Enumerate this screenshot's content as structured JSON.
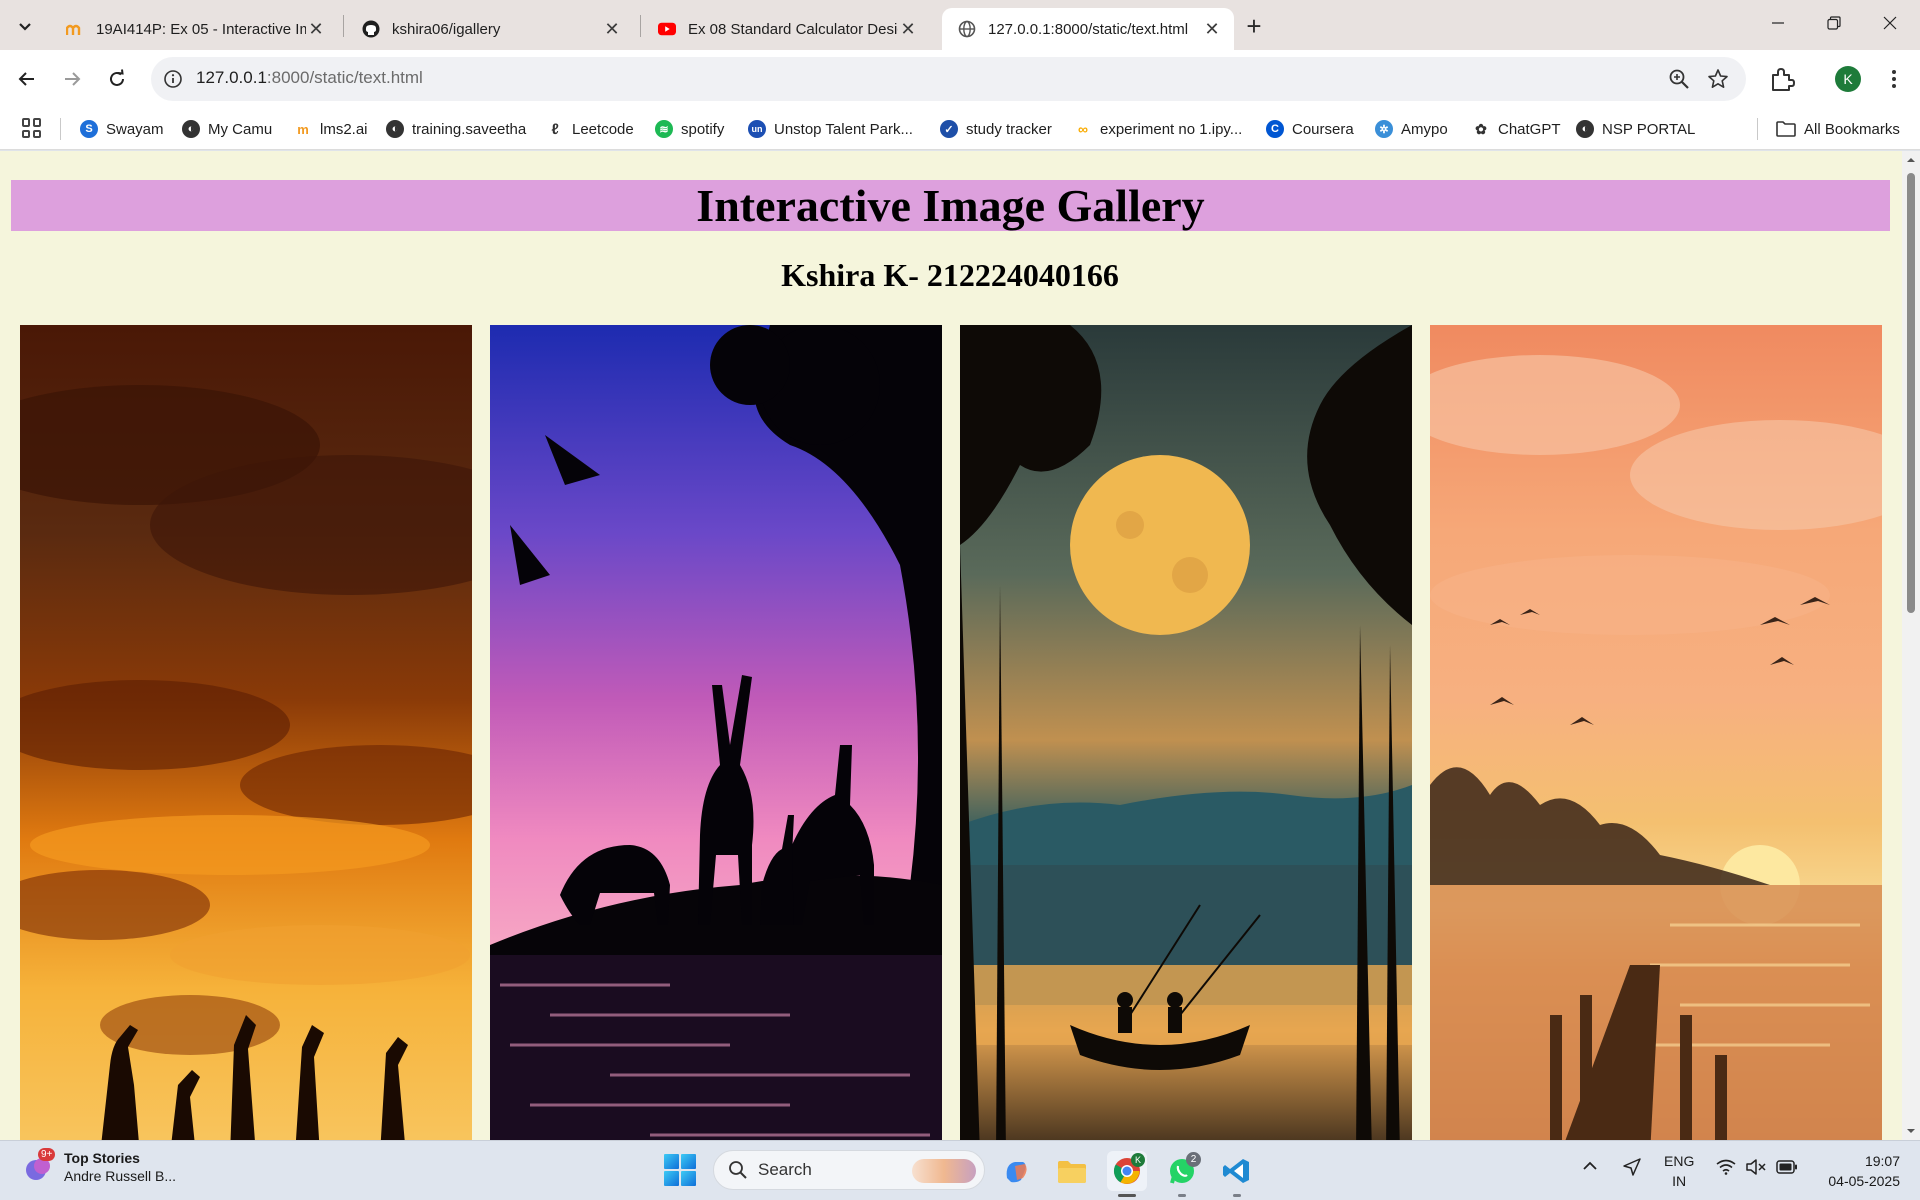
{
  "tabs": [
    {
      "title": "19AI414P: Ex 05 - Interactive Im",
      "favicon": "moodle-icon",
      "active": false
    },
    {
      "title": "kshira06/igallery",
      "favicon": "github-icon",
      "active": false
    },
    {
      "title": "Ex 08 Standard Calculator Desig",
      "favicon": "youtube-icon",
      "active": false
    },
    {
      "title": "127.0.0.1:8000/static/text.html",
      "favicon": "globe-icon",
      "active": true
    }
  ],
  "address_bar": {
    "host": "127.0.0.1",
    "path": ":8000/static/text.html"
  },
  "bookmarks": [
    {
      "label": "Swayam",
      "icon": "swayam-icon",
      "color": "#1e6fd9"
    },
    {
      "label": "My Camu",
      "icon": "globe-icon",
      "color": "#333333"
    },
    {
      "label": "lms2.ai",
      "icon": "moodle-icon",
      "color": "#f29a20"
    },
    {
      "label": "training.saveetha",
      "icon": "globe-icon",
      "color": "#333333"
    },
    {
      "label": "Leetcode",
      "icon": "leetcode-icon",
      "color": "#333333"
    },
    {
      "label": "spotify",
      "icon": "spotify-icon",
      "color": "#1db954"
    },
    {
      "label": "Unstop Talent Park...",
      "icon": "unstop-icon",
      "color": "#1c4fb3"
    },
    {
      "label": "study tracker",
      "icon": "tracker-icon",
      "color": "#1e4fa8"
    },
    {
      "label": "experiment no 1.ipy...",
      "icon": "colab-icon",
      "color": "#f9ab00"
    },
    {
      "label": "Coursera",
      "icon": "coursera-icon",
      "color": "#0056d2"
    },
    {
      "label": "Amypo",
      "icon": "amypo-icon",
      "color": "#3a8fd8"
    },
    {
      "label": "ChatGPT",
      "icon": "chatgpt-icon",
      "color": "#333333"
    },
    {
      "label": "NSP PORTAL",
      "icon": "globe-icon",
      "color": "#333333"
    }
  ],
  "all_bookmarks_label": "All Bookmarks",
  "profile_initial": "K",
  "page": {
    "heading": "Interactive Image Gallery",
    "subheading": "Kshira K- 212224040166"
  },
  "taskbar": {
    "news_title": "Top Stories",
    "news_subtitle": "Andre Russell B...",
    "news_badge": "9+",
    "search_label": "Search",
    "whatsapp_badge": "2",
    "lang_1": "ENG",
    "lang_2": "IN",
    "time": "19:07",
    "date": "04-05-2025"
  }
}
